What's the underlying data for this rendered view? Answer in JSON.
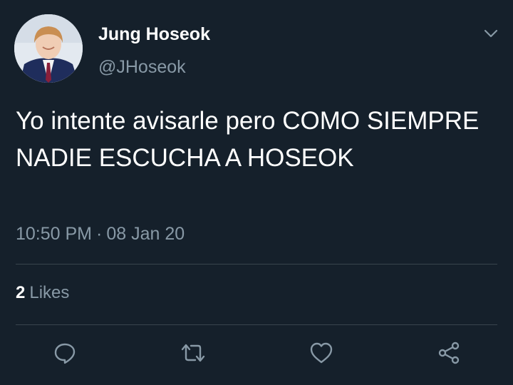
{
  "user": {
    "display_name": "Jung Hoseok",
    "handle": "@JHoseok"
  },
  "tweet": {
    "text": "Yo intente avisarle pero COMO SIEMPRE NADIE ESCUCHA A HOSEOK",
    "time": "10:50 PM",
    "separator": "·",
    "date": "08 Jan 20"
  },
  "stats": {
    "likes_count": "2",
    "likes_label": "Likes"
  },
  "icons": {
    "menu": "chevron-down-icon",
    "reply": "reply-icon",
    "retweet": "retweet-icon",
    "like": "heart-icon",
    "share": "share-icon"
  },
  "colors": {
    "background": "#15202b",
    "primary_text": "#ffffff",
    "secondary_text": "#8899a6",
    "divider": "#38444d"
  }
}
